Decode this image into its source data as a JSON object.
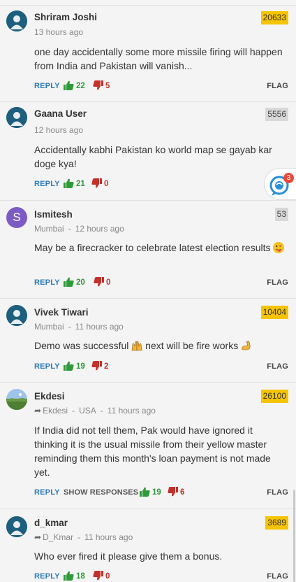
{
  "comments": [
    {
      "name": "Shriram Joshi",
      "time": "13 hours ago",
      "points": "20633",
      "badge_color": "#f6c400",
      "avatar": "default-avatar",
      "text": "one day accidentally some more missile firing will happen from India and Pakistan will vanish...",
      "reply": "REPLY",
      "up": "22",
      "down": "5",
      "flag": "FLAG"
    },
    {
      "name": "Gaana User",
      "time": "12 hours ago",
      "points": "5556",
      "badge_color": "#d8d8d8",
      "avatar": "default-avatar",
      "text": "Accidentally kabhi Pakistan ko world map se gayab kar doge kya!",
      "reply": "REPLY",
      "up": "21",
      "down": "0"
    },
    {
      "name": "Ismitesh",
      "avatar_letter": "S",
      "location": "Mumbai",
      "time": "12 hours ago",
      "points": "53",
      "badge_color": "#d8d8d8",
      "text": "May be a firecracker to celebrate latest election results",
      "reply": "REPLY",
      "up": "20",
      "down": "0",
      "flag": "FLAG"
    },
    {
      "name": "Vivek Tiwari",
      "location": "Mumbai",
      "time": "11 hours ago",
      "points": "10404",
      "badge_color": "#f6c400",
      "avatar": "default-avatar",
      "text_a": "Demo was successful",
      "text_b": "next will be fire works",
      "reply": "REPLY",
      "up": "19",
      "down": "2",
      "flag": "FLAG"
    },
    {
      "name": "Ekdesi",
      "handle": "Ekdesi",
      "country": "USA",
      "time": "11 hours ago",
      "points": "26100",
      "badge_color": "#f6c400",
      "avatar": "photo-avatar",
      "text": "If India did not tell them, Pak would have ignored it thinking it is the usual missile from their yellow master reminding them this month's loan payment is not made yet.",
      "reply": "REPLY",
      "show_responses": "SHOW RESPONSES",
      "up": "19",
      "down": "6",
      "flag": "FLAG"
    },
    {
      "name": "d_kmar",
      "handle": "D_Kmar",
      "time": "11 hours ago",
      "points": "3689",
      "badge_color": "#f6c400",
      "avatar": "default-avatar",
      "text": "Who ever fired it please give them a bonus.",
      "reply": "REPLY",
      "up": "18",
      "down": "0",
      "flag": "FLAG"
    }
  ],
  "chat_widget": {
    "icon": "chat-bubble-icon",
    "badge_count": "3"
  },
  "colors": {
    "reply_link": "#2a7bbd",
    "upvote": "#2f9a3a",
    "downvote": "#c5302a",
    "gold_badge": "#f6c400"
  }
}
